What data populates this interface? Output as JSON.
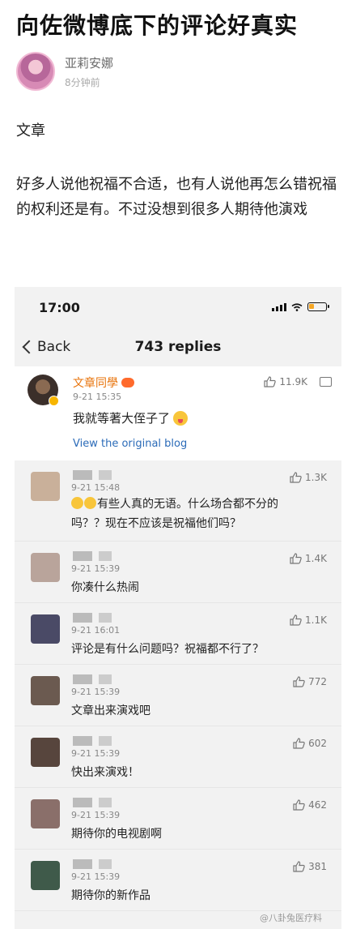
{
  "article": {
    "title": "向佐微博底下的评论好真实",
    "author": "亚莉安娜",
    "time": "8分钟前",
    "paragraph1": "文章",
    "paragraph2": "好多人说他祝福不合适，也有人说他再怎么错祝福的权利还是有。不过没想到很多人期待他演戏"
  },
  "screenshot": {
    "status_bar": {
      "time": "17:00",
      "icons": [
        "signal-icon",
        "wifi-icon",
        "battery-icon"
      ]
    },
    "nav": {
      "back_label": "Back",
      "title": "743 replies"
    },
    "main_comment": {
      "name": "文章同學",
      "time": "9-21 15:35",
      "text": "我就等著大侄子了",
      "likes": "11.9K",
      "link": "View the original blog"
    },
    "replies": [
      {
        "time": "9-21 15:48",
        "text": "有些人真的无语。什么场合都不分的吗？？现在不应该是祝福他们吗？",
        "likes": "1.3K",
        "emoji": true,
        "avatar_color": "#c9b09a"
      },
      {
        "time": "9-21 15:39",
        "text": "你凑什么热闹",
        "likes": "1.4K",
        "avatar_color": "#b9a49b"
      },
      {
        "time": "9-21 16:01",
        "text": "评论是有什么问题吗？祝福都不行了？",
        "likes": "1.1K",
        "avatar_color": "#4a4a66"
      },
      {
        "time": "9-21 15:39",
        "text": "文章出来演戏吧",
        "likes": "772",
        "avatar_color": "#6b5a50"
      },
      {
        "time": "9-21 15:39",
        "text": "快出来演戏！",
        "likes": "602",
        "avatar_color": "#57453d"
      },
      {
        "time": "9-21 15:39",
        "text": "期待你的电视剧啊",
        "likes": "462",
        "avatar_color": "#8a6f6a"
      },
      {
        "time": "9-21 15:39",
        "text": "期待你的新作品",
        "likes": "381",
        "avatar_color": "#3f5a4a"
      }
    ],
    "watermark": "@八卦兔医疗料"
  },
  "colors": {
    "accent_orange": "#e8740c",
    "link_blue": "#2b6bb8",
    "screenshot_bg": "#f2f2f2"
  }
}
